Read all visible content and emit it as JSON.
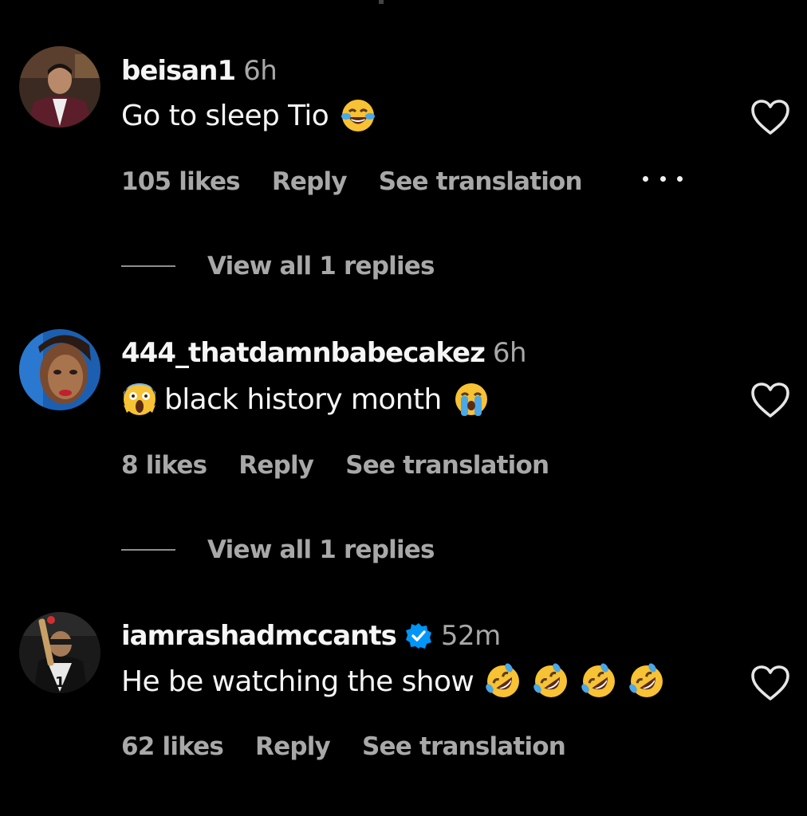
{
  "comments": [
    {
      "username": "beisan1",
      "time": "6h",
      "text": "Go to sleep Tio",
      "emoji": [
        "face-with-tears-of-joy"
      ],
      "likes": "105 likes",
      "reply": "Reply",
      "translate": "See translation",
      "replies": "View all 1 replies",
      "has_more_menu": true
    },
    {
      "username": "444_thatdamnbabecakez",
      "time": "6h",
      "text": "black history month",
      "emoji": [
        "face-screaming-in-fear",
        "loudly-crying-face"
      ],
      "likes": "8 likes",
      "reply": "Reply",
      "translate": "See translation",
      "replies": "View all 1 replies"
    },
    {
      "username": "iamrashadmccants",
      "verified": true,
      "time": "52m",
      "text": "He be watching the show",
      "emoji": [
        "rolling-on-the-floor-laughing",
        "rolling-on-the-floor-laughing",
        "rolling-on-the-floor-laughing",
        "rolling-on-the-floor-laughing"
      ],
      "likes": "62 likes",
      "reply": "Reply",
      "translate": "See translation"
    }
  ],
  "colors": {
    "background": "#000000",
    "primary_text": "#f5f5f5",
    "secondary_text": "#a8a8a8",
    "verified_blue": "#0095f6",
    "emoji_yellow": "#f7c233"
  }
}
